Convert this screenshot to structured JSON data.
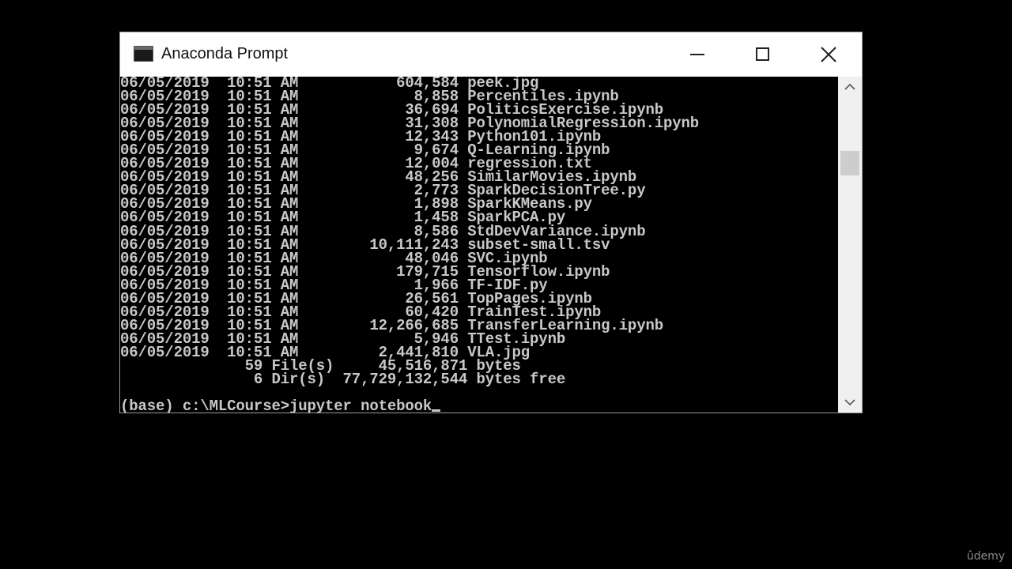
{
  "window": {
    "title": "Anaconda Prompt",
    "icon": "console-icon"
  },
  "title_controls": {
    "minimize": "minimize-icon",
    "maximize": "maximize-icon",
    "close": "close-icon"
  },
  "console": {
    "lines": [
      "06/05/2019  10:51 AM           604,584 peek.jpg",
      "06/05/2019  10:51 AM             8,858 Percentiles.ipynb",
      "06/05/2019  10:51 AM            36,694 PoliticsExercise.ipynb",
      "06/05/2019  10:51 AM            31,308 PolynomialRegression.ipynb",
      "06/05/2019  10:51 AM            12,343 Python101.ipynb",
      "06/05/2019  10:51 AM             9,674 Q-Learning.ipynb",
      "06/05/2019  10:51 AM            12,004 regression.txt",
      "06/05/2019  10:51 AM            48,256 SimilarMovies.ipynb",
      "06/05/2019  10:51 AM             2,773 SparkDecisionTree.py",
      "06/05/2019  10:51 AM             1,898 SparkKMeans.py",
      "06/05/2019  10:51 AM             1,458 SparkPCA.py",
      "06/05/2019  10:51 AM             8,586 StdDevVariance.ipynb",
      "06/05/2019  10:51 AM        10,111,243 subset-small.tsv",
      "06/05/2019  10:51 AM            48,046 SVC.ipynb",
      "06/05/2019  10:51 AM           179,715 Tensorflow.ipynb",
      "06/05/2019  10:51 AM             1,966 TF-IDF.py",
      "06/05/2019  10:51 AM            26,561 TopPages.ipynb",
      "06/05/2019  10:51 AM            60,420 TrainTest.ipynb",
      "06/05/2019  10:51 AM        12,266,685 TransferLearning.ipynb",
      "06/05/2019  10:51 AM             5,946 TTest.ipynb",
      "06/05/2019  10:51 AM         2,441,810 VLA.jpg",
      "              59 File(s)     45,516,871 bytes",
      "               6 Dir(s)  77,729,132,544 bytes free",
      ""
    ],
    "prompt_line": "(base) c:\\MLCourse>jupyter notebook"
  },
  "scrollbar": {
    "up": "chevron-up-icon",
    "down": "chevron-down-icon"
  },
  "watermark": "ûdemy",
  "colors": {
    "background": "#000000",
    "console_text": "#c8c8c8",
    "titlebar": "#ffffff",
    "scrollbar": "#f0f0f0"
  }
}
